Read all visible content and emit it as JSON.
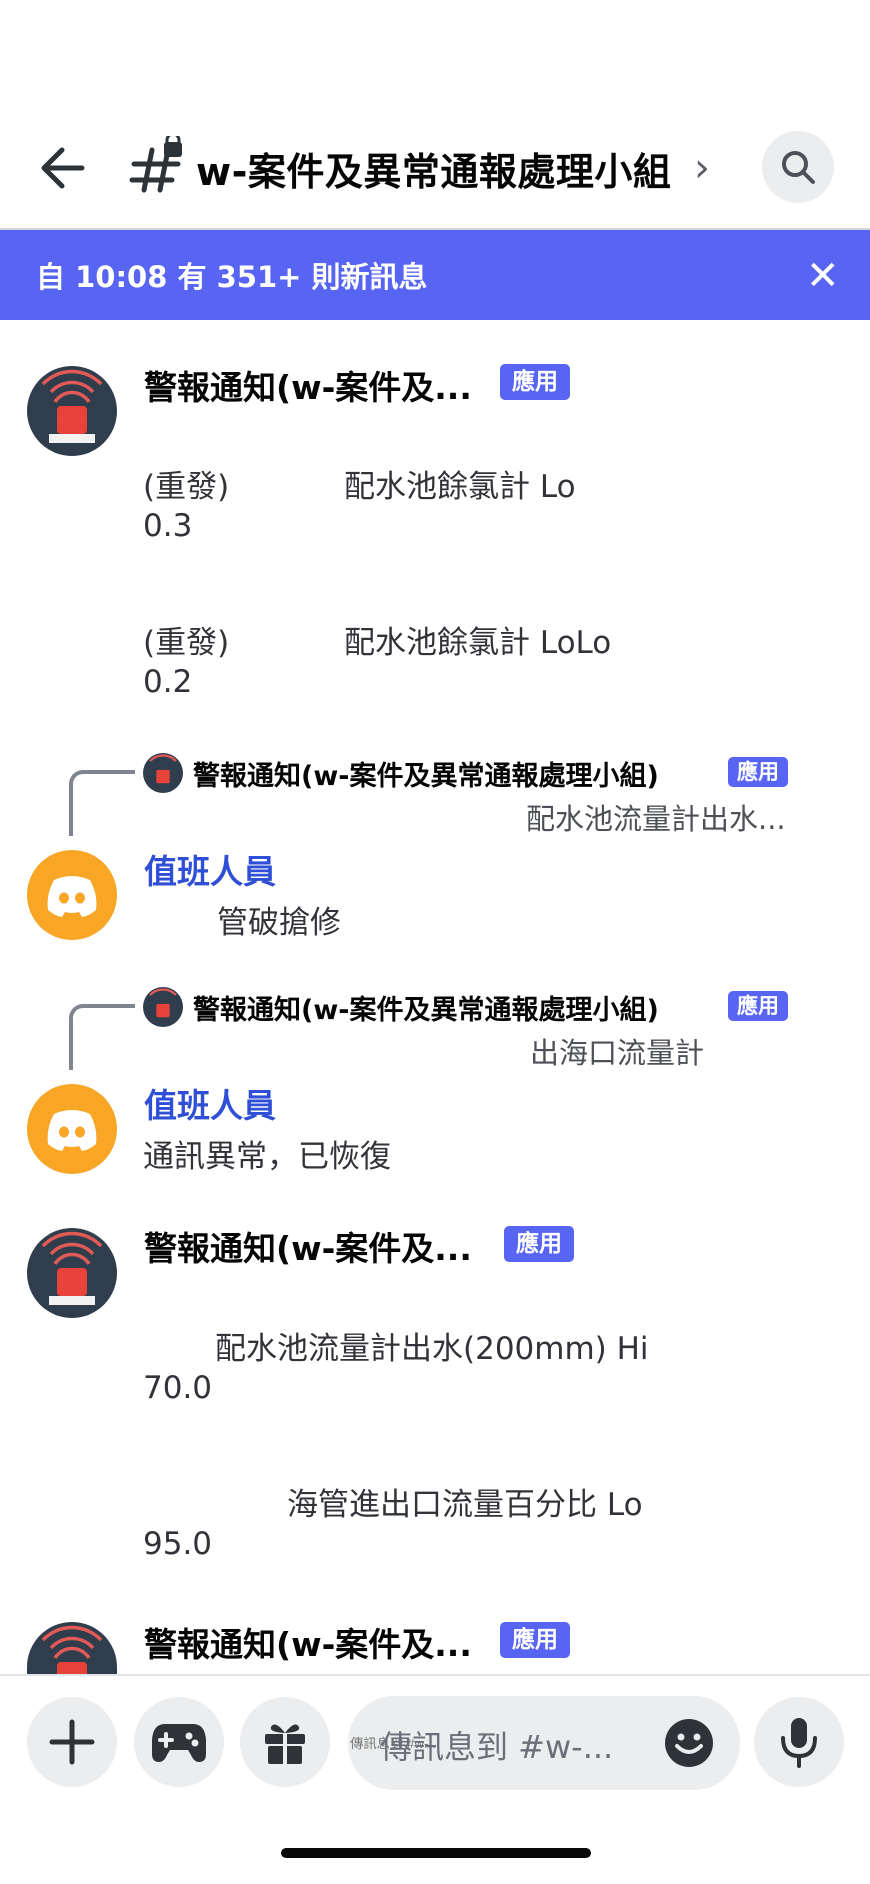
{
  "header": {
    "channel_title": "w-案件及異常通報處理小組",
    "chevron": "›"
  },
  "banner": {
    "text": "自 10:08 有 351+ 則新訊息",
    "close": "✕"
  },
  "messages": [
    {
      "author": "警報通知(w-案件及...",
      "badge": "應用",
      "lines": [
        "(重發)",
        "配水池餘氯計 Lo",
        "0.3",
        "(重發)",
        "配水池餘氯計 LoLo",
        "0.2"
      ]
    },
    {
      "reply_author": "警報通知(w-案件及異常通報處理小組)",
      "reply_badge": "應用",
      "reply_text": "配水池流量計出水...",
      "author": "值班人員",
      "lines": [
        "管破搶修"
      ]
    },
    {
      "reply_author": "警報通知(w-案件及異常通報處理小組)",
      "reply_badge": "應用",
      "reply_text": "出海口流量計",
      "author": "值班人員",
      "lines": [
        "通訊異常，已恢復"
      ]
    },
    {
      "author": "警報通知(w-案件及...",
      "badge": "應用",
      "lines": [
        "配水池流量計出水(200mm) Hi",
        "70.0",
        "海管進出口流量百分比 Lo",
        "95.0"
      ]
    },
    {
      "author": "警報通知(w-案件及...",
      "badge": "應用"
    }
  ],
  "composer": {
    "placeholder": "傳訊息到 #w-..."
  },
  "icons": {
    "back": "arrow-left-icon",
    "channel": "locked-hash-icon",
    "search": "search-icon",
    "plus": "plus-icon",
    "game": "gamepad-icon",
    "gift": "gift-icon",
    "emoji": "emoji-icon",
    "mic": "microphone-icon"
  },
  "colors": {
    "accent": "#5865f2",
    "username_blue": "#2f4fd6",
    "discord_avatar": "#f9a526",
    "alarm_avatar": "#2f3d4c"
  }
}
